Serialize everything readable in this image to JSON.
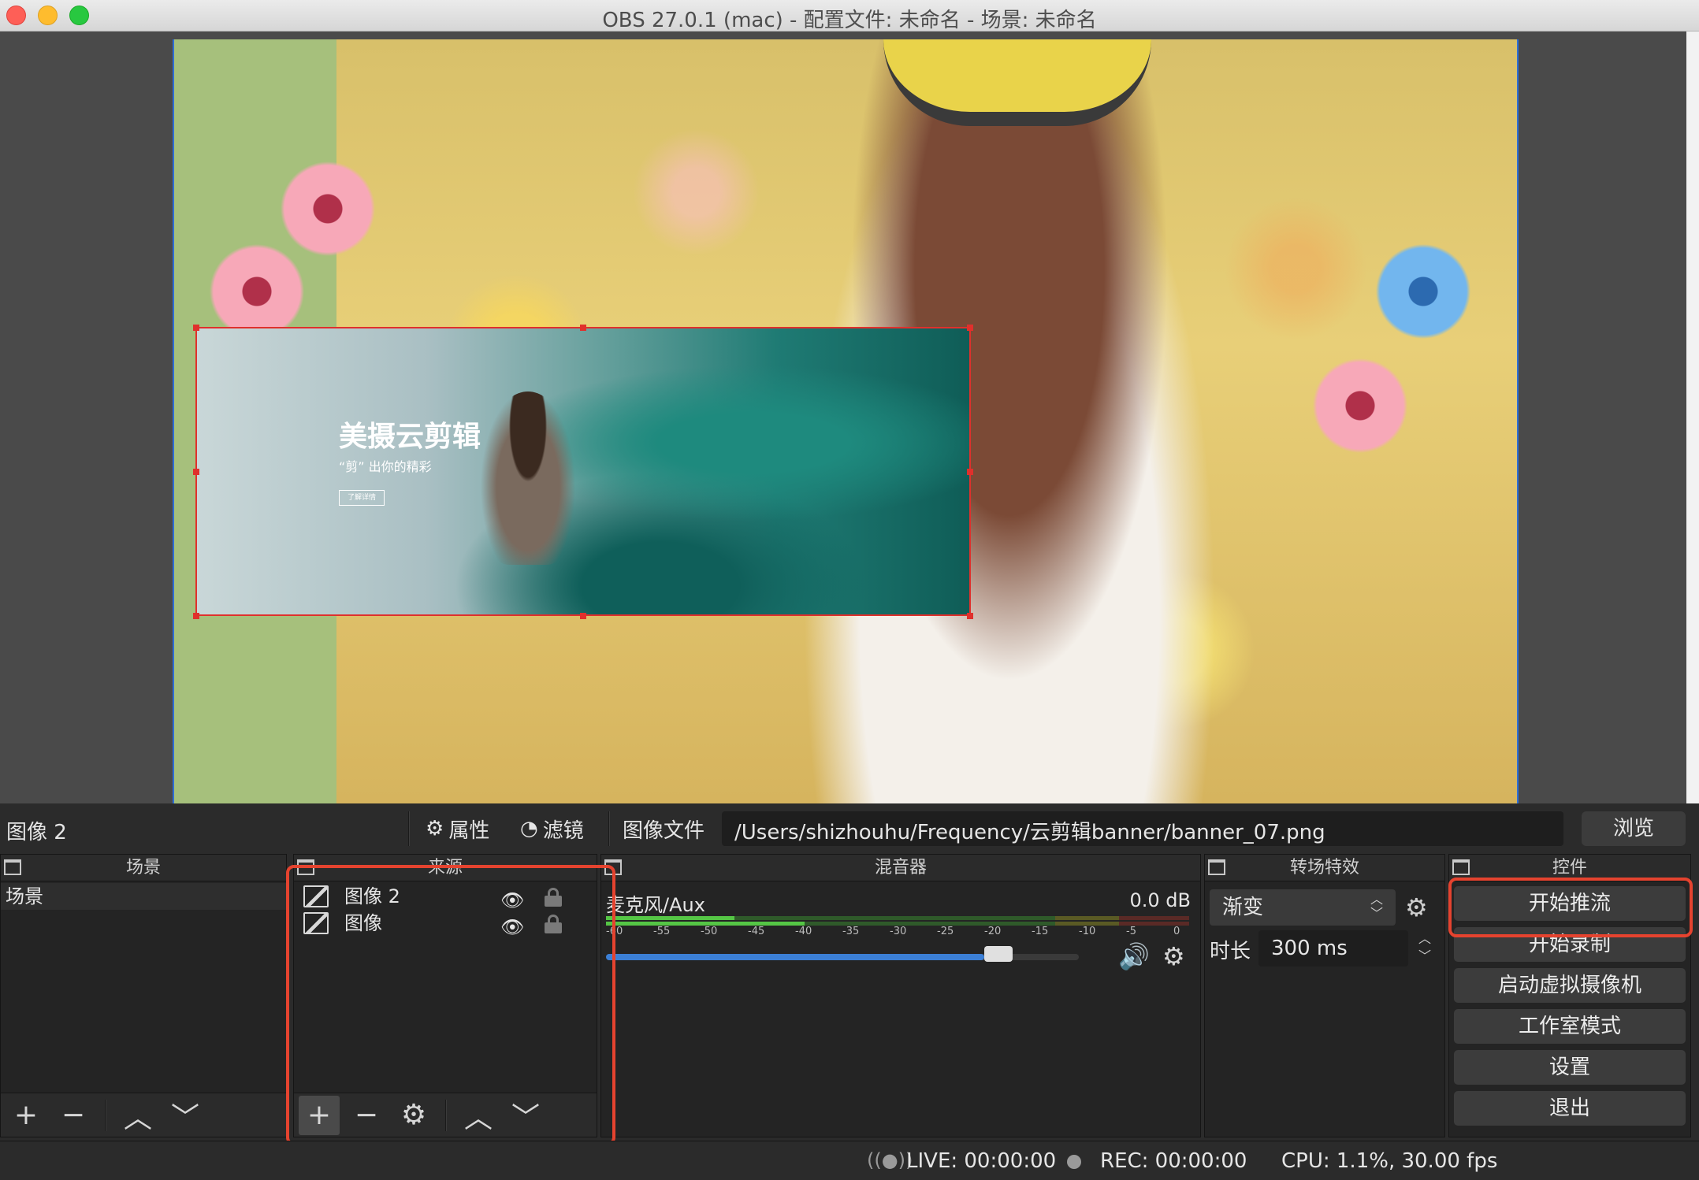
{
  "window": {
    "title": "OBS 27.0.1 (mac) - 配置文件: 未命名 - 场景: 未命名"
  },
  "preview": {
    "overlay": {
      "title": "美摄云剪辑",
      "subtitle": "“剪” 出你的精彩",
      "button": "了解详情"
    }
  },
  "properties_bar": {
    "selected_source": "图像 2",
    "properties_label": "属性",
    "filters_label": "滤镜",
    "image_file_label": "图像文件",
    "path_value": "/Users/shizhouhu/Frequency/云剪辑banner/banner_07.png",
    "browse_label": "浏览"
  },
  "docks": {
    "scenes": {
      "title": "场景",
      "items": [
        "场景"
      ]
    },
    "sources": {
      "title": "来源",
      "items": [
        {
          "name": "图像 2",
          "visible": true,
          "locked": false
        },
        {
          "name": "图像",
          "visible": true,
          "locked": false
        }
      ]
    },
    "mixer": {
      "title": "混音器",
      "track": {
        "name": "麦克风/Aux",
        "db": "0.0 dB",
        "volume_fraction": 0.8
      },
      "scale": [
        "-60",
        "-55",
        "-50",
        "-45",
        "-40",
        "-35",
        "-30",
        "-25",
        "-20",
        "-15",
        "-10",
        "-5",
        "0"
      ]
    },
    "transitions": {
      "title": "转场特效",
      "selected": "渐变",
      "duration_label": "时长",
      "duration_value": "300 ms"
    },
    "controls": {
      "title": "控件",
      "buttons": [
        "开始推流",
        "开始录制",
        "启动虚拟摄像机",
        "工作室模式",
        "设置",
        "退出"
      ]
    }
  },
  "status": {
    "live": "LIVE: 00:00:00",
    "rec": "REC: 00:00:00",
    "cpu": "CPU: 1.1%, 30.00 fps"
  },
  "colors": {
    "highlight": "#e5432f",
    "selection_border": "#e0302c",
    "volume": "#3b7fd6",
    "meter_green": "#55c645",
    "meter_yellow": "#c9c43b",
    "meter_red": "#c8463b"
  }
}
